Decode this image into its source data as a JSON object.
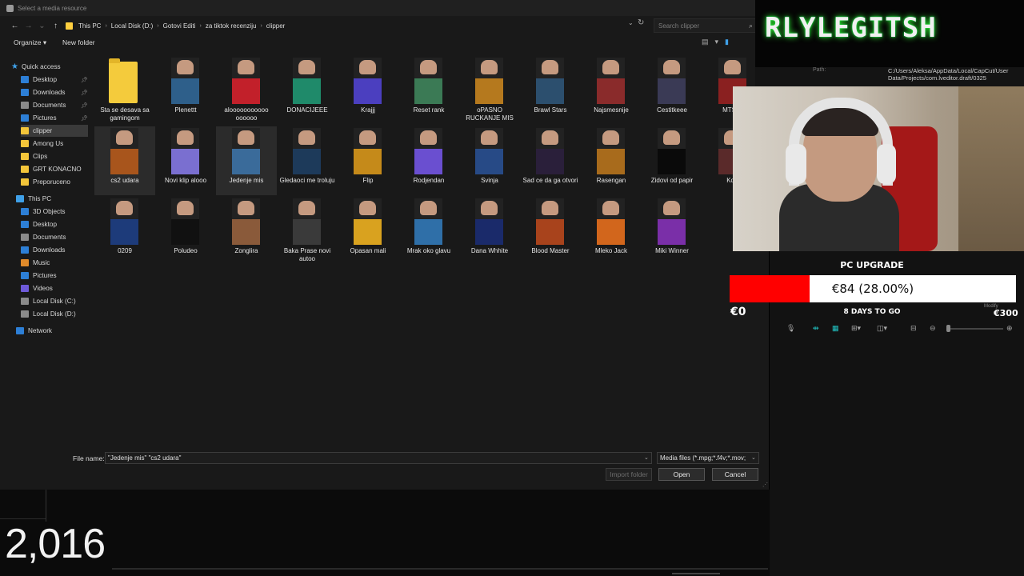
{
  "dialog": {
    "title": "Select a media resource",
    "breadcrumb": [
      "This PC",
      "Local Disk (D:)",
      "Gotovi Editi",
      "za tiktok recenziju",
      "clipper"
    ],
    "search_placeholder": "Search clipper",
    "organize_label": "Organize ▾",
    "new_folder_label": "New folder",
    "sidebar": {
      "quick_access": "Quick access",
      "quick_items": [
        "Desktop",
        "Downloads",
        "Documents",
        "Pictures",
        "clipper",
        "Among Us",
        "Clips",
        "GRT KONACNO",
        "Preporuceno"
      ],
      "this_pc": "This PC",
      "pc_items": [
        "3D Objects",
        "Desktop",
        "Documents",
        "Downloads",
        "Music",
        "Pictures",
        "Videos",
        "Local Disk (C:)",
        "Local Disk (D:)"
      ],
      "network": "Network"
    },
    "files": [
      {
        "name": "Sta se desava sa gamingom",
        "folder": true
      },
      {
        "name": "Plenettt",
        "color": "#2e5f8a"
      },
      {
        "name": "alooooooooooo oooooo",
        "color": "#c2202a"
      },
      {
        "name": "DONACIJEEE",
        "color": "#1f8a6a"
      },
      {
        "name": "Krajjj",
        "color": "#4b3fbf"
      },
      {
        "name": "Reset rank",
        "color": "#3b7a55"
      },
      {
        "name": "oPASNO RUCKANJE MIS",
        "color": "#b5791e"
      },
      {
        "name": "Brawl Stars",
        "color": "#2c4f6e"
      },
      {
        "name": "Najsmesnije",
        "color": "#8a2b2b"
      },
      {
        "name": "Cestitkeee",
        "color": "#3a3a55"
      },
      {
        "name": "MTS m",
        "color": "#8a2020"
      },
      {
        "name": "cs2 udara",
        "color": "#a8551c"
      },
      {
        "name": "Novi klip alooo",
        "color": "#7a6fd0"
      },
      {
        "name": "Jedenje mis",
        "color": "#3a6b9a"
      },
      {
        "name": "Gledaoci me troluju",
        "color": "#1d3a5a"
      },
      {
        "name": "Flip",
        "color": "#c58a1a"
      },
      {
        "name": "Rodjendan",
        "color": "#6a4fd0"
      },
      {
        "name": "Svinja",
        "color": "#274a86"
      },
      {
        "name": "Sad ce da ga otvori",
        "color": "#2a1f3a"
      },
      {
        "name": "Rasengan",
        "color": "#a86b1c"
      },
      {
        "name": "Zidovi od papir",
        "color": "#0a0a0a"
      },
      {
        "name": "Kosi",
        "color": "#5a2a2a"
      },
      {
        "name": "0209",
        "color": "#1d3b7a"
      },
      {
        "name": "Poludeo",
        "color": "#111111"
      },
      {
        "name": "Zonglira",
        "color": "#8a5a3a"
      },
      {
        "name": "Baka Prase novi autoo",
        "color": "#3a3a3a"
      },
      {
        "name": "Opasan mali",
        "color": "#d9a21f"
      },
      {
        "name": "Mrak oko glavu",
        "color": "#2f6fa8"
      },
      {
        "name": "Dana Whhite",
        "color": "#1a2a6a"
      },
      {
        "name": "Blood Master",
        "color": "#a8431c"
      },
      {
        "name": "Mleko Jack",
        "color": "#d2661c"
      },
      {
        "name": "Miki Winner",
        "color": "#7a2fa8"
      }
    ],
    "file_name_label": "File name:",
    "file_name_value": "\"Jedenje mis\" \"cs2 udara\"",
    "file_type_value": "Media files (*.mpg;*.f4v;*.mov;",
    "import_folder_label": "Import folder",
    "open_label": "Open",
    "cancel_label": "Cancel"
  },
  "overlay": {
    "logo_text": "RLYLEGITSH",
    "path_label": "Path:",
    "path_text": "C:/Users/Aleksa/AppData/Local/CapCut/User Data/Projects/com.lveditor.draft/0325",
    "goal": {
      "title": "PC UPGRADE",
      "amount": "€84 (28.00%)",
      "progress_percent": 28,
      "days": "8 DAYS TO GO",
      "min": "€0",
      "max": "€300",
      "modify": "Modify"
    },
    "counter": "2,016"
  },
  "colors": {
    "goal_fill": "#ff0000",
    "accent": "#22c8c8",
    "folder": "#f4cb3c"
  }
}
